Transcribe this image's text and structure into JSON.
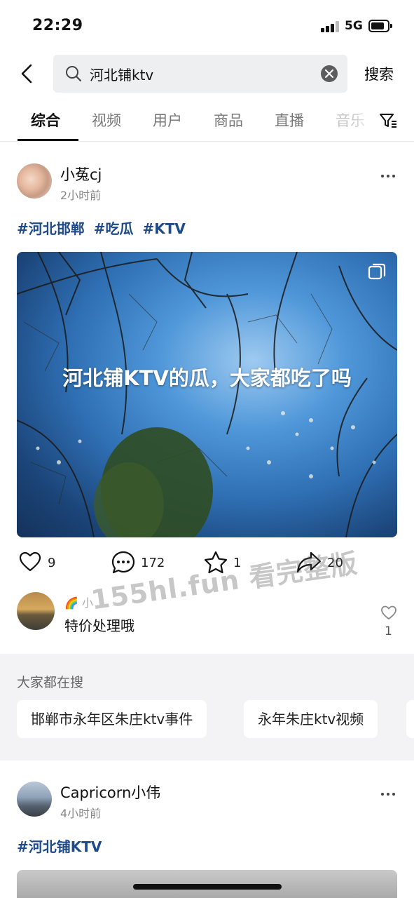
{
  "status_bar": {
    "time": "22:29",
    "network": "5G"
  },
  "search": {
    "query": "河北铺ktv",
    "button_label": "搜索"
  },
  "tabs": [
    {
      "label": "综合",
      "active": true
    },
    {
      "label": "视频"
    },
    {
      "label": "用户"
    },
    {
      "label": "商品"
    },
    {
      "label": "直播"
    },
    {
      "label": "音乐"
    }
  ],
  "post1": {
    "username": "小菟cj",
    "time": "2小时前",
    "hashtags": [
      "#河北邯郸",
      "#吃瓜",
      "#KTV"
    ],
    "cover_caption": "河北铺KTV的瓜，大家都吃了吗",
    "likes": "9",
    "comments": "172",
    "favorites": "1",
    "shares": "20"
  },
  "watermark": "155hl.fun 看完整版",
  "top_comment": {
    "name": "🌈 小",
    "text": "特价处理哦",
    "likes": "1"
  },
  "trending": {
    "title": "大家都在搜",
    "items": [
      "邯郸市永年区朱庄ktv事件",
      "永年朱庄ktv视频"
    ]
  },
  "post2": {
    "username": "Capricorn小伟",
    "time": "4小时前",
    "hashtags": [
      "#河北铺KTV"
    ]
  },
  "colors": {
    "hashtag": "#1e4a8a",
    "trending_bg": "#f3f3f5"
  }
}
